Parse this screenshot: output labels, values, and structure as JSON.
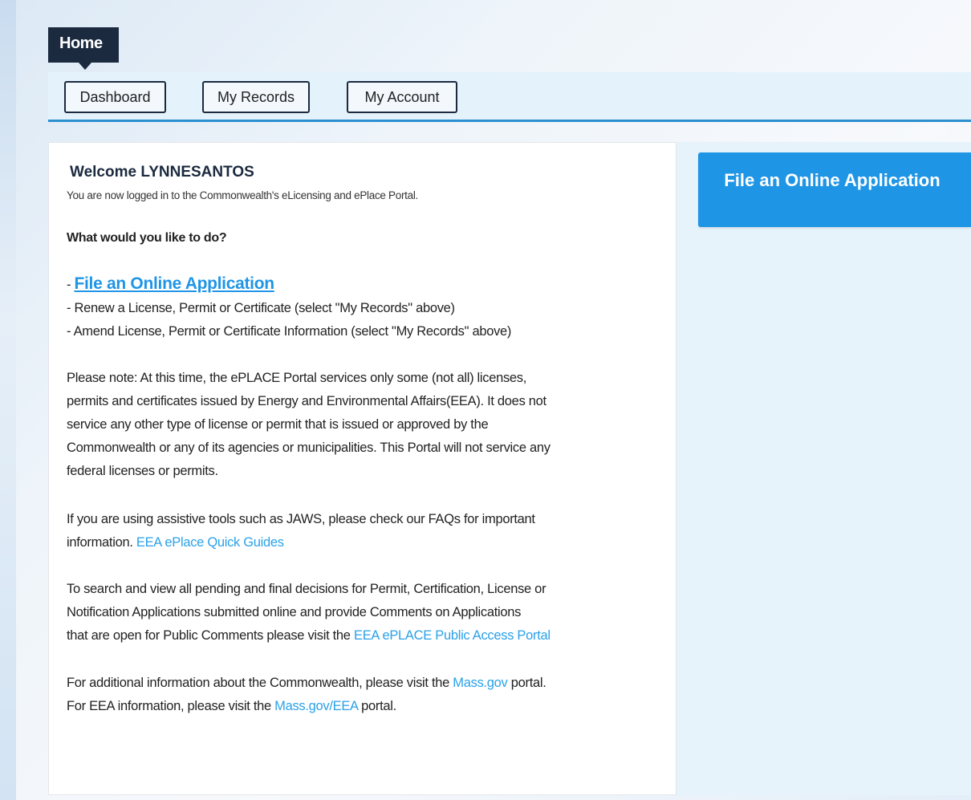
{
  "header": {
    "home_tab": "Home"
  },
  "nav": {
    "items": [
      {
        "label": "Dashboard"
      },
      {
        "label": "My Records"
      },
      {
        "label": "My Account"
      }
    ]
  },
  "welcome": {
    "title": "Welcome LYNNESANTOS",
    "subtitle": "You are now logged in to the Commonwealth's eLicensing and ePlace Portal."
  },
  "actions": {
    "question": "What would you like to do?",
    "dash": "- ",
    "file_link": "File an Online Application",
    "renew": "- Renew a License, Permit or Certificate (select \"My Records\" above)",
    "amend": "- Amend License, Permit or Certificate Information (select \"My Records\" above)"
  },
  "note": {
    "lines": [
      "Please note: At this time, the ePLACE Portal services only some (not all) licenses,",
      "permits and certificates issued by Energy and Environmental Affairs(EEA). It does not",
      "service any other type of license or permit that is issued or approved by the",
      "Commonwealth or any of its agencies or municipalities. This Portal will not service any",
      "federal licenses or permits."
    ]
  },
  "assistive": {
    "line1": "If you are using assistive tools such as JAWS, please check our FAQs for important",
    "line2_pre": "information. ",
    "guides_link": "EEA ePlace Quick Guides"
  },
  "search": {
    "line1": "To search and view all pending and final decisions for Permit, Certification, License or",
    "line2": "Notification Applications submitted online and provide Comments on Applications",
    "line3_pre": "that are open for Public Comments please visit the ",
    "portal_link": "EEA ePLACE Public Access Portal"
  },
  "additional": {
    "line1_pre": "For additional information about the Commonwealth, please visit the ",
    "massgov_link": "Mass.gov",
    "line1_post": " portal.",
    "line2_pre": "For EEA information, please visit the ",
    "eea_link": "Mass.gov/EEA",
    "line2_post": " portal."
  },
  "sidebar": {
    "file_button": "File an Online Application"
  },
  "colors": {
    "accent": "#1f95e6",
    "dark": "#1b2a3f",
    "nav_bg": "#e4f2fb"
  }
}
